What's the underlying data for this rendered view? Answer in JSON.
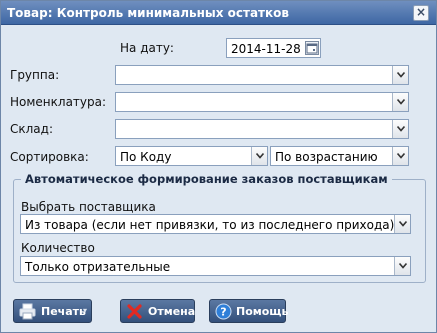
{
  "window": {
    "title": "Товар: Контроль минимальных остатков"
  },
  "form": {
    "date_label": "На дату:",
    "date_value": "2014-11-28",
    "group_label": "Группа:",
    "group_value": "",
    "nomenclature_label": "Номенклатура:",
    "nomenclature_value": "",
    "warehouse_label": "Склад:",
    "warehouse_value": "",
    "sort_label": "Сортировка:",
    "sort_field_value": "По Коду",
    "sort_order_value": "По возрастанию"
  },
  "auto_orders": {
    "legend": "Автоматическое формирование заказов поставщикам",
    "supplier_label": "Выбрать поставщика",
    "supplier_value": "Из товара (если нет привязки, то из последнего прихода)",
    "quantity_label": "Количество",
    "quantity_value": "Только отризательные"
  },
  "buttons": {
    "print": "Печать",
    "cancel": "Отмена",
    "help": "Помощь"
  }
}
